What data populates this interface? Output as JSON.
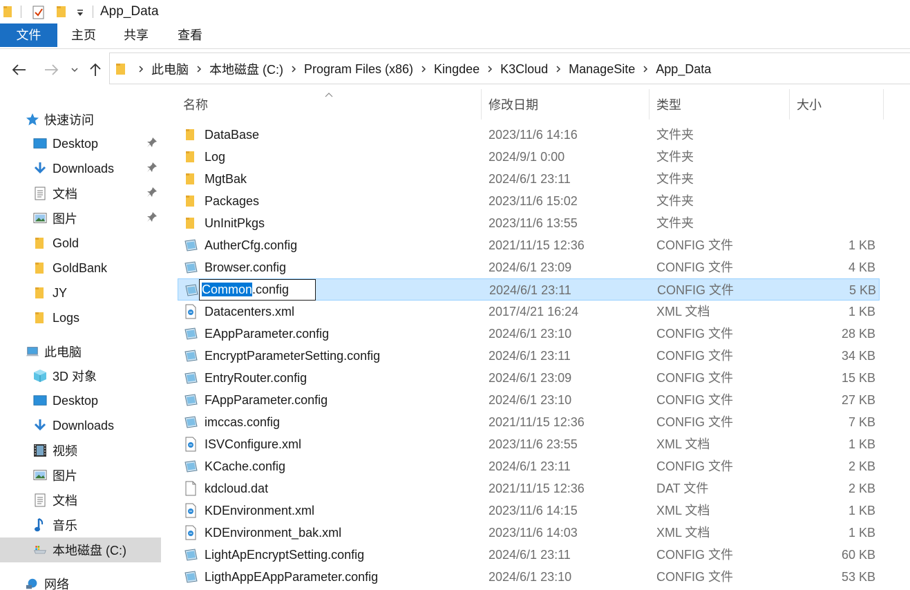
{
  "window": {
    "title": "App_Data"
  },
  "ribbon": {
    "tabs": [
      "文件",
      "主页",
      "共享",
      "查看"
    ]
  },
  "address": {
    "crumbs": [
      "此电脑",
      "本地磁盘 (C:)",
      "Program Files (x86)",
      "Kingdee",
      "K3Cloud",
      "ManageSite",
      "App_Data"
    ]
  },
  "sidebar": {
    "quick_access": "快速访问",
    "quick_items": [
      {
        "label": "Desktop",
        "icon": "desktop-icon",
        "pinned": true
      },
      {
        "label": "Downloads",
        "icon": "downloads-icon",
        "pinned": true
      },
      {
        "label": "文档",
        "icon": "documents-icon",
        "pinned": true
      },
      {
        "label": "图片",
        "icon": "pictures-icon",
        "pinned": true
      },
      {
        "label": "Gold",
        "icon": "folder-icon",
        "pinned": false
      },
      {
        "label": "GoldBank",
        "icon": "folder-icon",
        "pinned": false
      },
      {
        "label": "JY",
        "icon": "folder-icon",
        "pinned": false
      },
      {
        "label": "Logs",
        "icon": "folder-icon",
        "pinned": false
      }
    ],
    "this_pc": "此电脑",
    "pc_items": [
      {
        "label": "3D 对象",
        "icon": "3d-objects-icon"
      },
      {
        "label": "Desktop",
        "icon": "desktop-icon"
      },
      {
        "label": "Downloads",
        "icon": "downloads-icon"
      },
      {
        "label": "视频",
        "icon": "videos-icon"
      },
      {
        "label": "图片",
        "icon": "pictures-icon"
      },
      {
        "label": "文档",
        "icon": "documents-icon"
      },
      {
        "label": "音乐",
        "icon": "music-icon"
      },
      {
        "label": "本地磁盘 (C:)",
        "icon": "drive-icon",
        "selected": true
      }
    ],
    "network": "网络"
  },
  "columns": {
    "name": "名称",
    "date": "修改日期",
    "type": "类型",
    "size": "大小"
  },
  "files": [
    {
      "name": "DataBase",
      "date": "2023/11/6 14:16",
      "type": "文件夹",
      "size": "",
      "icon": "folder"
    },
    {
      "name": "Log",
      "date": "2024/9/1 0:00",
      "type": "文件夹",
      "size": "",
      "icon": "folder"
    },
    {
      "name": "MgtBak",
      "date": "2024/6/1 23:11",
      "type": "文件夹",
      "size": "",
      "icon": "folder"
    },
    {
      "name": "Packages",
      "date": "2023/11/6 15:02",
      "type": "文件夹",
      "size": "",
      "icon": "folder"
    },
    {
      "name": "UnInitPkgs",
      "date": "2023/11/6 13:55",
      "type": "文件夹",
      "size": "",
      "icon": "folder"
    },
    {
      "name": "AutherCfg.config",
      "date": "2021/11/15 12:36",
      "type": "CONFIG 文件",
      "size": "1 KB",
      "icon": "config"
    },
    {
      "name": "Browser.config",
      "date": "2024/6/1 23:09",
      "type": "CONFIG 文件",
      "size": "4 KB",
      "icon": "config"
    },
    {
      "name": "Common.config",
      "date": "2024/6/1 23:11",
      "type": "CONFIG 文件",
      "size": "5 KB",
      "icon": "config",
      "selected": true,
      "rename_selected": "Common",
      "rename_rest": ".config"
    },
    {
      "name": "Datacenters.xml",
      "date": "2017/4/21 16:24",
      "type": "XML 文档",
      "size": "1 KB",
      "icon": "xml"
    },
    {
      "name": "EAppParameter.config",
      "date": "2024/6/1 23:10",
      "type": "CONFIG 文件",
      "size": "28 KB",
      "icon": "config"
    },
    {
      "name": "EncryptParameterSetting.config",
      "date": "2024/6/1 23:11",
      "type": "CONFIG 文件",
      "size": "34 KB",
      "icon": "config"
    },
    {
      "name": "EntryRouter.config",
      "date": "2024/6/1 23:09",
      "type": "CONFIG 文件",
      "size": "15 KB",
      "icon": "config"
    },
    {
      "name": "FAppParameter.config",
      "date": "2024/6/1 23:10",
      "type": "CONFIG 文件",
      "size": "27 KB",
      "icon": "config"
    },
    {
      "name": "imccas.config",
      "date": "2021/11/15 12:36",
      "type": "CONFIG 文件",
      "size": "7 KB",
      "icon": "config"
    },
    {
      "name": "ISVConfigure.xml",
      "date": "2023/11/6 23:55",
      "type": "XML 文档",
      "size": "1 KB",
      "icon": "xml"
    },
    {
      "name": "KCache.config",
      "date": "2024/6/1 23:11",
      "type": "CONFIG 文件",
      "size": "2 KB",
      "icon": "config"
    },
    {
      "name": "kdcloud.dat",
      "date": "2021/11/15 12:36",
      "type": "DAT 文件",
      "size": "2 KB",
      "icon": "blank"
    },
    {
      "name": "KDEnvironment.xml",
      "date": "2023/11/6 14:15",
      "type": "XML 文档",
      "size": "1 KB",
      "icon": "xml"
    },
    {
      "name": "KDEnvironment_bak.xml",
      "date": "2023/11/6 14:03",
      "type": "XML 文档",
      "size": "1 KB",
      "icon": "xml"
    },
    {
      "name": "LightApEncryptSetting.config",
      "date": "2024/6/1 23:11",
      "type": "CONFIG 文件",
      "size": "60 KB",
      "icon": "config"
    },
    {
      "name": "LigthAppEAppParameter.config",
      "date": "2024/6/1 23:10",
      "type": "CONFIG 文件",
      "size": "53 KB",
      "icon": "config"
    }
  ]
}
